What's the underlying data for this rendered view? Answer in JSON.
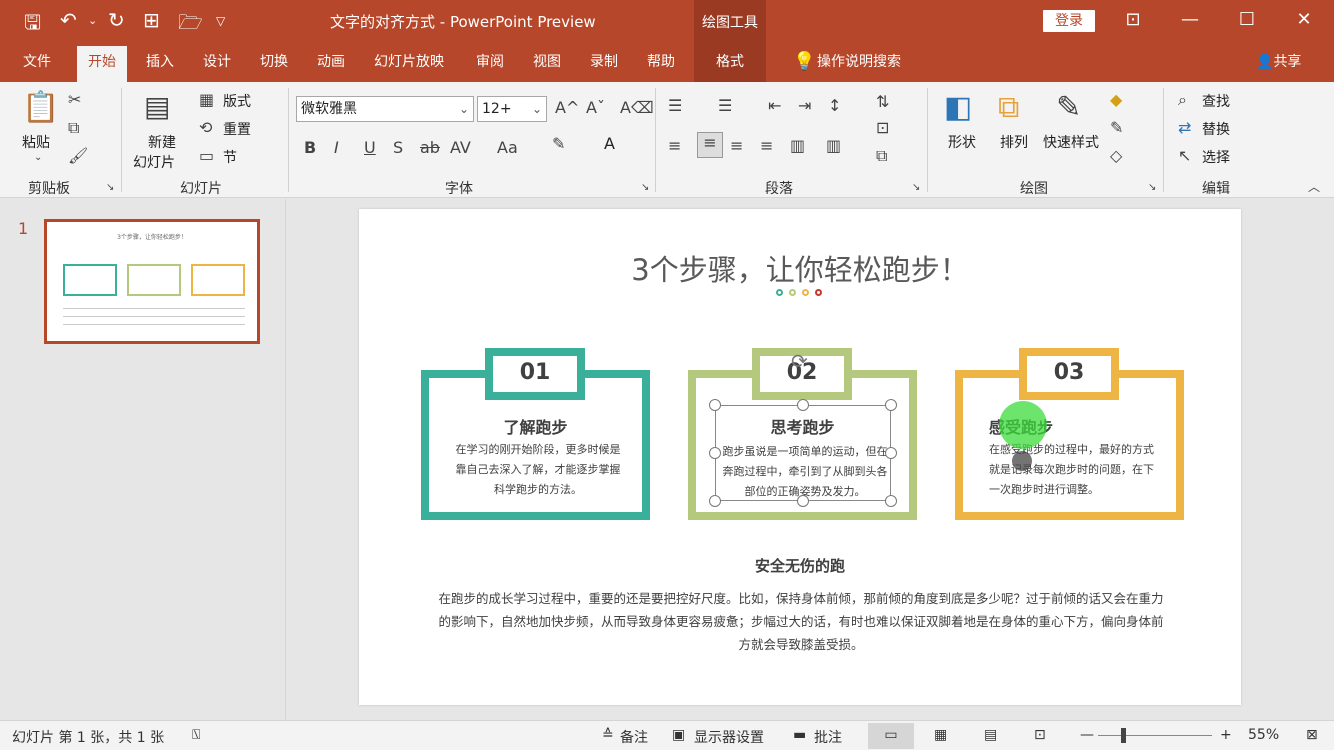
{
  "window": {
    "title": "文字的对齐方式 - PowerPoint Preview",
    "contextual_tab": "绘图工具",
    "login_label": "登录"
  },
  "tabs": [
    "文件",
    "开始",
    "插入",
    "设计",
    "切换",
    "动画",
    "幻灯片放映",
    "审阅",
    "视图",
    "录制",
    "帮助",
    "格式"
  ],
  "active_tab": "开始",
  "tell_me": "操作说明搜索",
  "share": "共享",
  "ribbon": {
    "clipboard": {
      "paste": "粘贴",
      "label": "剪贴板"
    },
    "slides": {
      "new_slide_1": "新建",
      "new_slide_2": "幻灯片",
      "layout": "版式",
      "reset": "重置",
      "section": "节",
      "label": "幻灯片"
    },
    "font": {
      "name": "微软雅黑",
      "size": "12+",
      "label": "字体"
    },
    "paragraph": {
      "label": "段落"
    },
    "drawing": {
      "shapes": "形状",
      "arrange": "排列",
      "quick_styles": "快速样式",
      "label": "绘图"
    },
    "editing": {
      "find": "查找",
      "replace": "替换",
      "select": "选择",
      "label": "编辑"
    }
  },
  "thumbnail": {
    "number": "1"
  },
  "slide": {
    "title": "3个步骤，让你轻松跑步！",
    "dots": [
      "#3aaf9a",
      "#b5c97e",
      "#efb544",
      "#c0392b"
    ],
    "cards": [
      {
        "num": "01",
        "title": "了解跑步",
        "text": "在学习的刚开始阶段，更多时候是靠自己去深入了解，才能逐步掌握科学跑步的方法。",
        "color": "#3aaf9a"
      },
      {
        "num": "02",
        "title": "思考跑步",
        "text": "跑步虽说是一项简单的运动，但在奔跑过程中，牵引到了从脚到头各部位的正确姿势及发力。",
        "color": "#b5c97e"
      },
      {
        "num": "03",
        "title": "感受跑步",
        "text": "在感受跑步的过程中，最好的方式就是记录每次跑步时的问题，在下一次跑步时进行调整。",
        "color": "#efb544"
      }
    ],
    "section_title": "安全无伤的跑",
    "section_text": "在跑步的成长学习过程中，重要的还是要把控好尺度。比如，保持身体前倾，那前倾的角度到底是多少呢？过于前倾的话又会在重力的影响下，自然地加快步频，从而导致身体更容易疲惫；步幅过大的话，有时也难以保证双脚着地是在身体的重心下方，偏向身体前方就会导致膝盖受损。"
  },
  "status": {
    "slide_info": "幻灯片 第 1 张，共 1 张",
    "notes": "备注",
    "display": "显示器设置",
    "comments": "批注",
    "zoom": "55%"
  }
}
